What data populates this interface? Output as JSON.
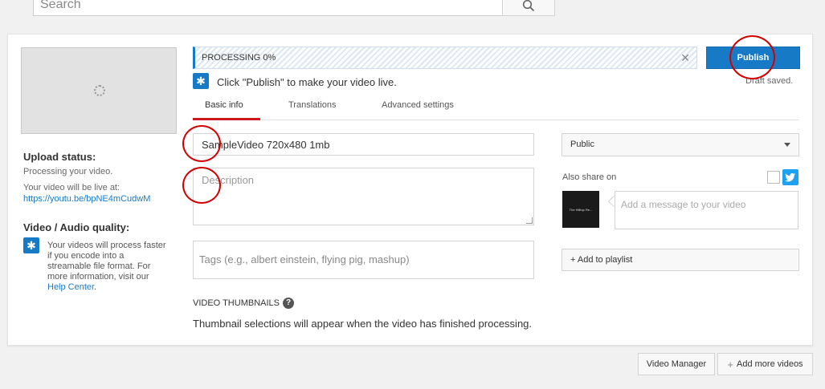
{
  "search": {
    "placeholder": "Search"
  },
  "upload": {
    "title": "Upload status:",
    "processing": "Processing your video.",
    "live_text": "Your video will be live at:",
    "link": "https://youtu.be/bpNE4mCudwM"
  },
  "quality": {
    "title": "Video / Audio quality:",
    "text": "Your videos will process faster if you encode into a streamable file format. For more information, visit our",
    "link": "Help Center",
    "suffix": "."
  },
  "progress": {
    "label": "PROCESSING 0%",
    "percent": 0
  },
  "publish": {
    "label": "Publish",
    "draft_status": "Draft saved."
  },
  "hint": "Click \"Publish\" to make your video live.",
  "tabs": [
    {
      "label": "Basic info",
      "active": true
    },
    {
      "label": "Translations",
      "active": false
    },
    {
      "label": "Advanced settings",
      "active": false
    }
  ],
  "form": {
    "title_value": "SampleVideo 720x480 1mb",
    "description_placeholder": "Description",
    "tags_placeholder": "Tags (e.g., albert einstein, flying pig, mashup)"
  },
  "thumbnails": {
    "heading": "VIDEO THUMBNAILS",
    "help_glyph": "?",
    "text": "Thumbnail selections will appear when the video has finished processing."
  },
  "privacy": {
    "selected": "Public"
  },
  "share": {
    "label": "Also share on",
    "message_placeholder": "Add a message to your video",
    "avatar_text": "The Hilltop Re..."
  },
  "playlist": {
    "label": "+ Add to playlist"
  },
  "bottom": {
    "video_manager": "Video Manager",
    "add_more_icon": "+",
    "add_more": "Add more videos"
  },
  "colors": {
    "accent": "#167ac6",
    "tab_underline": "#cc181e",
    "annotation": "#d40000",
    "twitter": "#1da1f2"
  },
  "icons": [
    "search-icon",
    "spinner-icon",
    "info-star-icon",
    "close-icon",
    "help-icon",
    "dropdown-caret-icon",
    "twitter-icon",
    "resize-grip-icon"
  ]
}
